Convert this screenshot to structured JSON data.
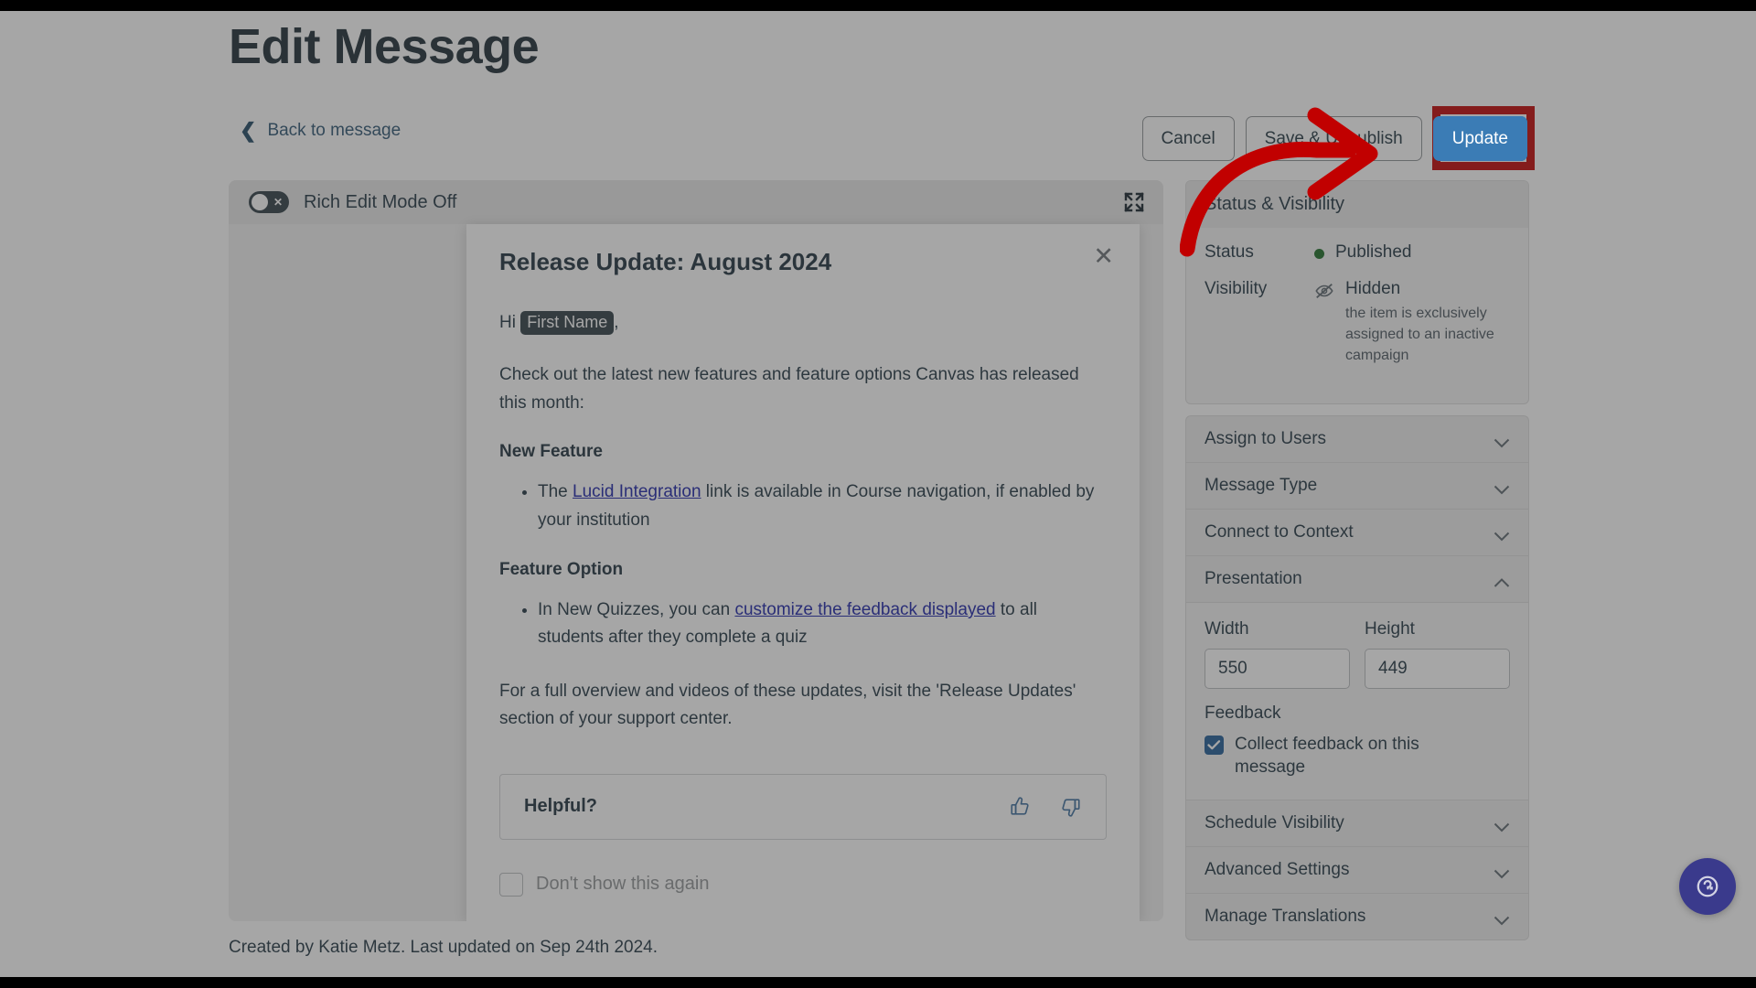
{
  "header": {
    "title": "Edit Message",
    "back_link": "Back to message"
  },
  "actions": {
    "cancel_label": "Cancel",
    "save_unpublish_label": "Save & Unpublish",
    "update_label": "Update",
    "primary_color": "#3b7cb5",
    "annotation_color": "#c10000"
  },
  "editor": {
    "rich_edit_toggle_label": "Rich Edit Mode Off",
    "rich_edit_toggle_state": "off",
    "expand_icon": "expand-icon"
  },
  "message": {
    "title": "Release Update: August 2024",
    "close_icon": "close-icon",
    "greeting_prefix": "Hi ",
    "greeting_token": "First Name",
    "greeting_suffix": ",",
    "intro": "Check out the latest new features and feature options Canvas has released this month:",
    "sections": [
      {
        "heading": "New Feature",
        "bullet_before": "The ",
        "bullet_link": "Lucid Integration",
        "bullet_after": " link is available in Course navigation, if enabled by your institution"
      },
      {
        "heading": "Feature Option",
        "bullet_before": "In New Quizzes, you can ",
        "bullet_link": "customize the feedback displayed",
        "bullet_after": " to all students after they complete a quiz"
      }
    ],
    "outro": "For a full overview and videos of these updates, visit the 'Release Updates' section of your support center.",
    "helpful_label": "Helpful?",
    "thumbs_up_icon": "thumbs-up-icon",
    "thumbs_down_icon": "thumbs-down-icon",
    "dont_show_label": "Don't show this again",
    "dont_show_checked": false
  },
  "footer": {
    "meta": "Created by Katie Metz. Last updated on Sep 24th 2024."
  },
  "sidebar": {
    "status_card": {
      "heading": "Status & Visibility",
      "status_label": "Status",
      "status_value": "Published",
      "status_color": "#1a6b24",
      "visibility_label": "Visibility",
      "visibility_value": "Hidden",
      "visibility_icon": "eye-hidden-icon",
      "visibility_note": "the item is exclusively assigned to an inactive campaign"
    },
    "accordions": [
      {
        "label": "Assign to Users",
        "state": "collapsed"
      },
      {
        "label": "Message Type",
        "state": "collapsed"
      },
      {
        "label": "Connect to Context",
        "state": "collapsed"
      },
      {
        "label": "Presentation",
        "state": "expanded"
      }
    ],
    "presentation": {
      "width_label": "Width",
      "width_value": "550",
      "height_label": "Height",
      "height_value": "449",
      "feedback_label": "Feedback",
      "collect_feedback_label": "Collect feedback on this message",
      "collect_feedback_checked": true
    },
    "accordions_bottom": [
      {
        "label": "Schedule Visibility",
        "state": "collapsed"
      },
      {
        "label": "Advanced Settings",
        "state": "collapsed"
      },
      {
        "label": "Manage Translations",
        "state": "collapsed"
      }
    ]
  },
  "help_fab": {
    "icon": "help-chat-icon",
    "color": "#3a3a8c"
  }
}
